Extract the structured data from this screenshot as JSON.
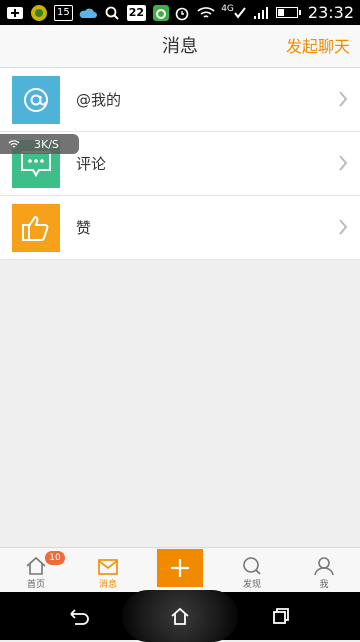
{
  "status_bar": {
    "notif_15": "15",
    "notif_22": "22",
    "network": "4G",
    "time": "23:32"
  },
  "header": {
    "title": "消息",
    "action": "发起聊天"
  },
  "list": [
    {
      "label": "@我的",
      "icon": "at-icon",
      "color": "#4fb3d9"
    },
    {
      "label": "评论",
      "icon": "comment-icon",
      "color": "#3dbf8a"
    },
    {
      "label": "赞",
      "icon": "thumbs-up-icon",
      "color": "#f5a21a"
    }
  ],
  "net_speed": "3K/S",
  "bottom_nav": {
    "home": "首页",
    "home_badge": "10",
    "messages": "消息",
    "discover": "发现",
    "me": "我"
  },
  "colors": {
    "accent": "#f08c00",
    "badge": "#f06a3a"
  }
}
